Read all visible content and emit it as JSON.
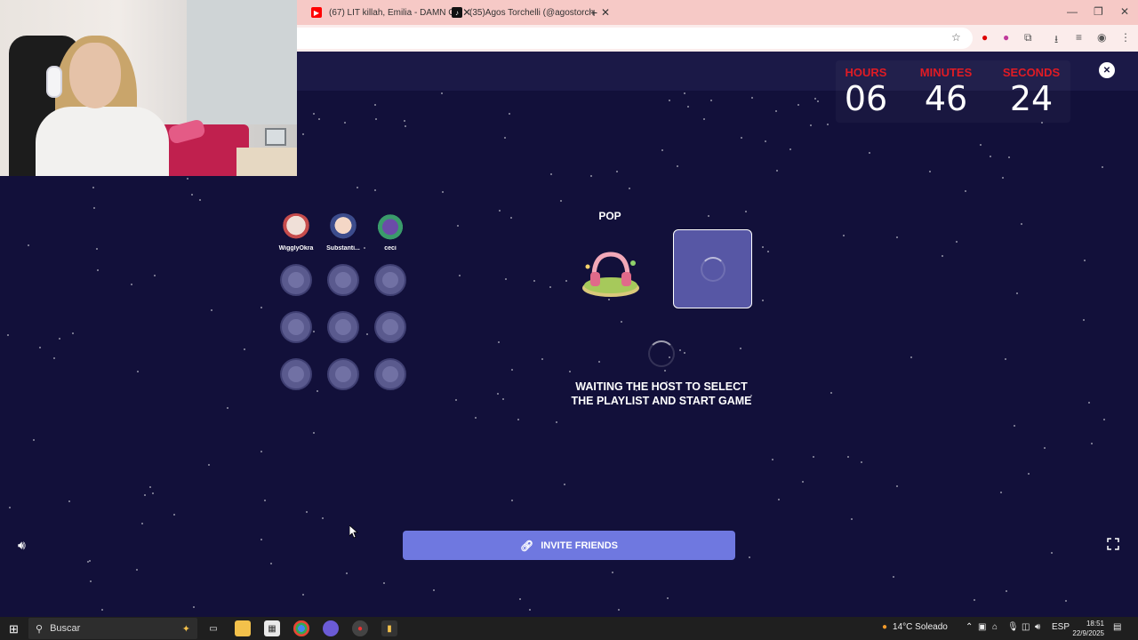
{
  "browser": {
    "tabs": [
      {
        "title": "(67) LIT killah, Emilia - DAMN G",
        "icon": "youtube-icon"
      },
      {
        "title": "(35)Agos Torchelli (@agostorch",
        "icon": "tiktok-icon"
      }
    ],
    "new_tab_icon": "plus-icon"
  },
  "countdown": {
    "hours_label": "HOURS",
    "hours": "06",
    "minutes_label": "MINUTES",
    "minutes": "46",
    "seconds_label": "SECONDS",
    "seconds": "24"
  },
  "players": [
    {
      "name": "WigglyOkra"
    },
    {
      "name": "Substanti..."
    },
    {
      "name": "ceci"
    }
  ],
  "playlist": {
    "genre": "POP"
  },
  "status": {
    "line1": "WAITING THE HOST TO SELECT",
    "line2": "THE PLAYLIST AND START GAME"
  },
  "invite": {
    "label": "INVITE FRIENDS"
  },
  "taskbar": {
    "search_placeholder": "Buscar",
    "weather": "14°C  Soleado",
    "language": "ESP",
    "time": "18:51",
    "date": "22/9/2025"
  },
  "colors": {
    "background": "#12103a",
    "accent_red": "#e01b24",
    "invite_button": "#6f78e0",
    "select_box": "#5757a5"
  }
}
